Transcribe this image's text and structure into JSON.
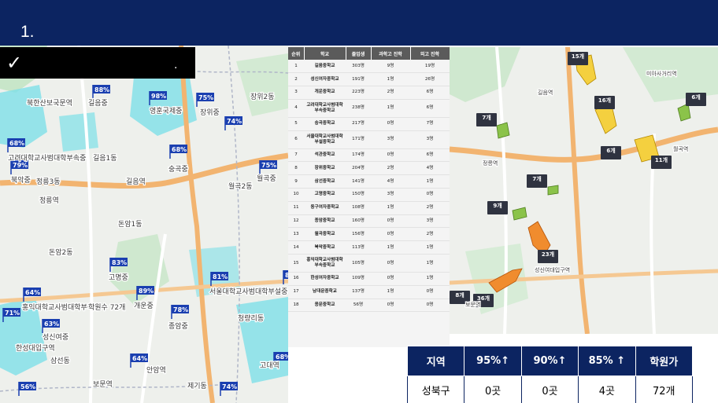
{
  "header": {
    "slide_number": "1."
  },
  "caption": {
    "check_glyph": "✓",
    "period": "."
  },
  "map_left": {
    "labels": [
      {
        "text": "북한산보국문역"
      },
      {
        "text": "길음1동"
      },
      {
        "text": "정릉3동"
      },
      {
        "text": "정릉역"
      },
      {
        "text": "길음역"
      },
      {
        "text": "돈암1동"
      },
      {
        "text": "돈암2동"
      },
      {
        "text": "고려대학교사범대학부속중"
      },
      {
        "text": "북악중"
      },
      {
        "text": "길음중"
      },
      {
        "text": "영훈국제중"
      },
      {
        "text": "장위중"
      },
      {
        "text": "숭곡중"
      },
      {
        "text": "월곡중"
      },
      {
        "text": "고명중"
      },
      {
        "text": "홍익대학교사범대학부속중"
      },
      {
        "text": "개운중"
      },
      {
        "text": "성신여중"
      },
      {
        "text": "종암중"
      },
      {
        "text": "한성대입구역"
      },
      {
        "text": "삼선동"
      },
      {
        "text": "보문역"
      },
      {
        "text": "안암역"
      },
      {
        "text": "제기동"
      },
      {
        "text": "서울대학교사범대학부설중"
      },
      {
        "text": "월곡2동"
      },
      {
        "text": "장위2동"
      },
      {
        "text": "청량리동"
      },
      {
        "text": "고대역"
      },
      {
        "text": "학원수 72개"
      }
    ],
    "badges": [
      {
        "text": "88%"
      },
      {
        "text": "98%"
      },
      {
        "text": "75%"
      },
      {
        "text": "74%"
      },
      {
        "text": "68%"
      },
      {
        "text": "79%"
      },
      {
        "text": "68%"
      },
      {
        "text": "75%"
      },
      {
        "text": "83%"
      },
      {
        "text": "81%"
      },
      {
        "text": "64%"
      },
      {
        "text": "89%"
      },
      {
        "text": "71%"
      },
      {
        "text": "63%"
      },
      {
        "text": "78%"
      },
      {
        "text": "64%"
      },
      {
        "text": "56%"
      },
      {
        "text": "74%"
      },
      {
        "text": "68%"
      },
      {
        "text": "8"
      }
    ]
  },
  "ranking_table": {
    "headers": [
      "순위",
      "학교",
      "졸업생",
      "과학고 진학",
      "외고 진학"
    ],
    "rows": [
      {
        "rank": "1",
        "school": "길음중학교",
        "grads": "303명",
        "sci": "9명",
        "lang": "19명"
      },
      {
        "rank": "2",
        "school": "성신여자중학교",
        "grads": "191명",
        "sci": "1명",
        "lang": "26명"
      },
      {
        "rank": "3",
        "school": "개운중학교",
        "grads": "223명",
        "sci": "2명",
        "lang": "6명"
      },
      {
        "rank": "4",
        "school": "고려대학교사범대학부속중학교",
        "grads": "238명",
        "sci": "1명",
        "lang": "6명"
      },
      {
        "rank": "5",
        "school": "숭곡중학교",
        "grads": "217명",
        "sci": "0명",
        "lang": "7명"
      },
      {
        "rank": "6",
        "school": "서울대학교사범대학부설중학교",
        "grads": "171명",
        "sci": "3명",
        "lang": "3명"
      },
      {
        "rank": "7",
        "school": "석관중학교",
        "grads": "174명",
        "sci": "0명",
        "lang": "6명"
      },
      {
        "rank": "8",
        "school": "장위중학교",
        "grads": "204명",
        "sci": "2명",
        "lang": "4명"
      },
      {
        "rank": "9",
        "school": "삼선중학교",
        "grads": "141명",
        "sci": "4명",
        "lang": "1명"
      },
      {
        "rank": "10",
        "school": "고명중학교",
        "grads": "150명",
        "sci": "3명",
        "lang": "0명"
      },
      {
        "rank": "11",
        "school": "동구여자중학교",
        "grads": "108명",
        "sci": "1명",
        "lang": "2명"
      },
      {
        "rank": "12",
        "school": "종암중학교",
        "grads": "160명",
        "sci": "0명",
        "lang": "3명"
      },
      {
        "rank": "13",
        "school": "월곡중학교",
        "grads": "156명",
        "sci": "0명",
        "lang": "2명"
      },
      {
        "rank": "14",
        "school": "북악중학교",
        "grads": "113명",
        "sci": "1명",
        "lang": "1명"
      },
      {
        "rank": "15",
        "school": "홍익대학교사범대학부속중학교",
        "grads": "105명",
        "sci": "0명",
        "lang": "1명"
      },
      {
        "rank": "16",
        "school": "한성여자중학교",
        "grads": "109명",
        "sci": "0명",
        "lang": "1명"
      },
      {
        "rank": "17",
        "school": "남대문중학교",
        "grads": "137명",
        "sci": "1명",
        "lang": "0명"
      },
      {
        "rank": "18",
        "school": "용문중학교",
        "grads": "56명",
        "sci": "0명",
        "lang": "0명"
      }
    ]
  },
  "map_right": {
    "labels": [
      {
        "text": "정릉역"
      },
      {
        "text": "길음역"
      },
      {
        "text": "미아사거리역"
      },
      {
        "text": "성신여대입구역"
      },
      {
        "text": "월곡역"
      },
      {
        "text": "보문역"
      }
    ],
    "badges": [
      {
        "text": "15개"
      },
      {
        "text": "16개"
      },
      {
        "text": "6개"
      },
      {
        "text": "7개"
      },
      {
        "text": "6개"
      },
      {
        "text": "11개"
      },
      {
        "text": "7개"
      },
      {
        "text": "9개"
      },
      {
        "text": "23개"
      },
      {
        "text": "36개"
      },
      {
        "text": "8개"
      }
    ]
  },
  "summary_table": {
    "headers": [
      "지역",
      "95%↑",
      "90%↑",
      "85% ↑",
      "학원가"
    ],
    "row": [
      "성북구",
      "0곳",
      "0곳",
      "4곳",
      "72개"
    ]
  },
  "colors": {
    "navy": "#0c2461",
    "map_land": "#eef0ec",
    "map_green": "#c8e6c9",
    "map_cyan": "#7ee0e8",
    "road_orange": "#f2b470",
    "badge_blue": "#1a3fb0",
    "zone_orange": "#f08c2e",
    "zone_yellow": "#f4d03f",
    "zone_green": "#8bc34a"
  }
}
